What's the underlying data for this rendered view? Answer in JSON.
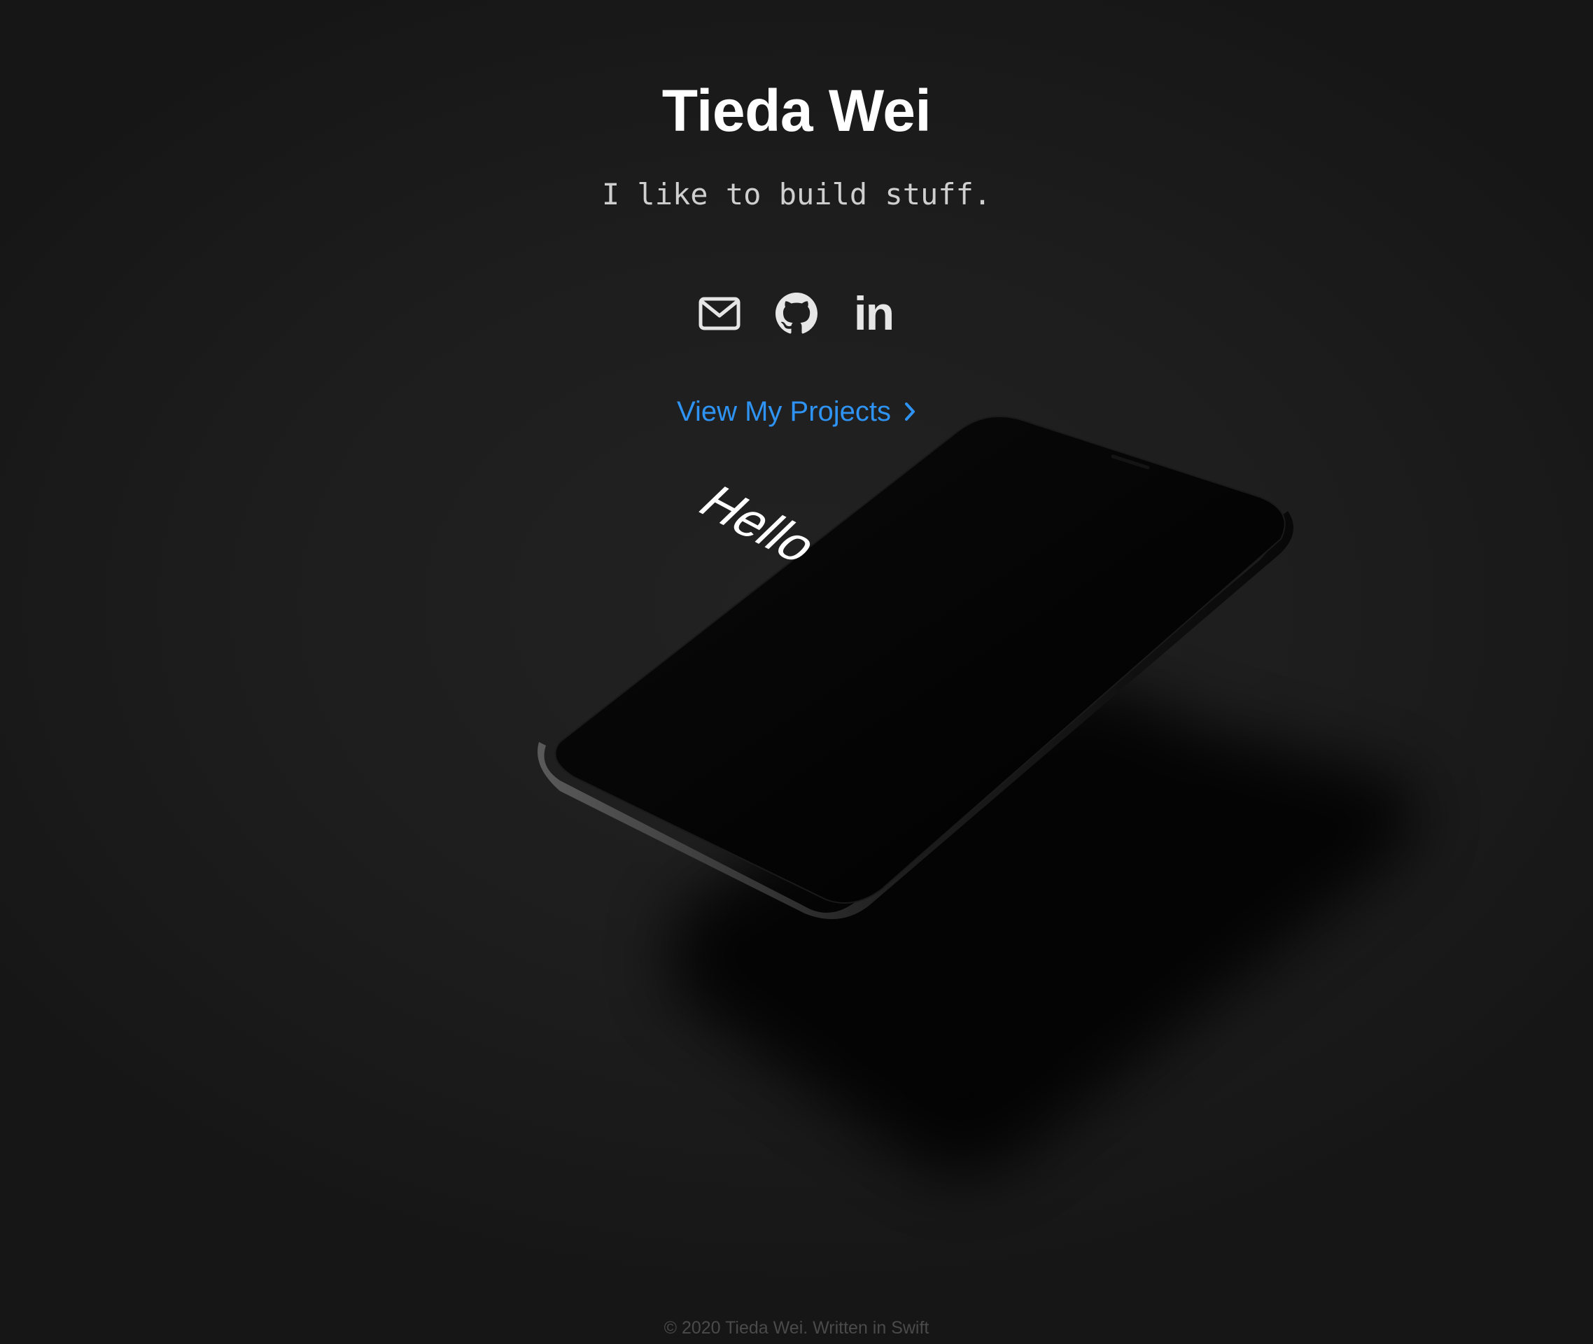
{
  "header": {
    "title": "Tieda Wei",
    "tagline": "I like to build stuff."
  },
  "social": {
    "email_icon": "envelope-icon",
    "github_icon": "github-icon",
    "linkedin_icon": "linkedin-icon",
    "linkedin_text": "in"
  },
  "cta": {
    "label": "View My Projects",
    "icon": "chevron-right-icon",
    "color": "#2e93f2"
  },
  "background": {
    "phone_screen_text": "Hello"
  },
  "footer": {
    "text": "© 2020 Tieda Wei. Written in Swift"
  }
}
